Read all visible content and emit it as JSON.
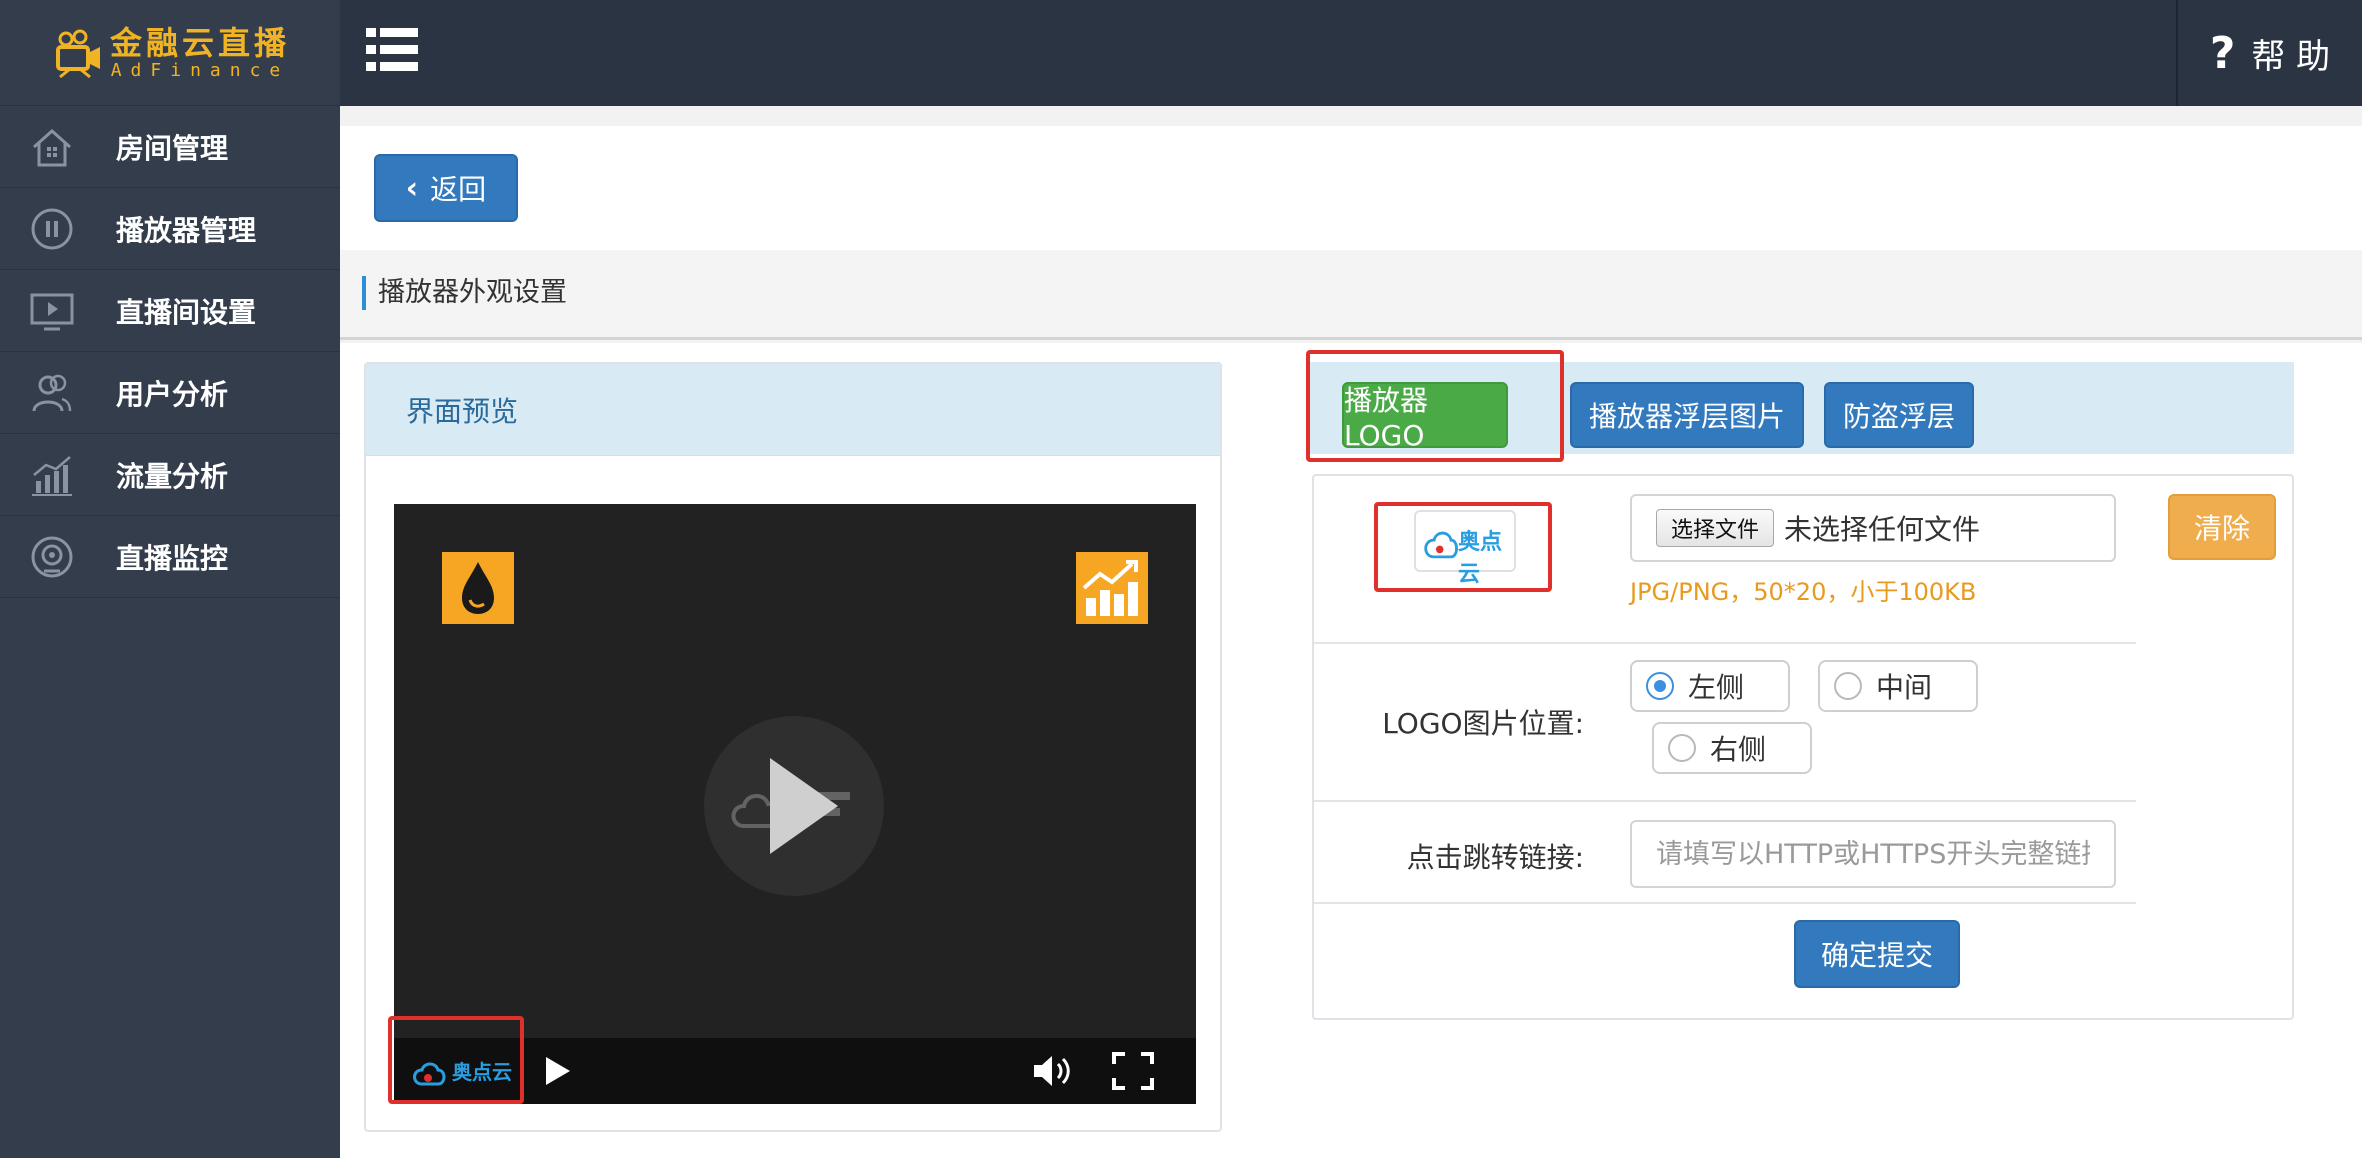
{
  "brand": {
    "name_cn": "金融云直播",
    "name_en": "AdFinance",
    "color": "#f0b323"
  },
  "sidebar": {
    "items": [
      {
        "label": "房间管理",
        "icon": "house-icon"
      },
      {
        "label": "播放器管理",
        "icon": "pause-circle-icon"
      },
      {
        "label": "直播间设置",
        "icon": "monitor-play-icon"
      },
      {
        "label": "用户分析",
        "icon": "users-icon"
      },
      {
        "label": "流量分析",
        "icon": "bar-chart-icon"
      },
      {
        "label": "直播监控",
        "icon": "webcam-icon"
      }
    ]
  },
  "topbar": {
    "menu_icon": "list-icon",
    "help_icon": "?",
    "help_label": "帮 助"
  },
  "toolbar": {
    "back_label": "返回"
  },
  "section": {
    "title": "播放器外观设置"
  },
  "preview": {
    "title": "界面预览",
    "player_logo_text": "奥点云"
  },
  "tabs": [
    {
      "label": "播放器LOGO",
      "active": true
    },
    {
      "label": "播放器浮层图片",
      "active": false
    },
    {
      "label": "防盗浮层",
      "active": false
    }
  ],
  "form": {
    "thumb_logo_text": "奥点云",
    "file_button_label": "选择文件",
    "file_status": "未选择任何文件",
    "file_hint": "JPG/PNG，50*20，小于100KB",
    "clear_label": "清除",
    "position_label": "LOGO图片位置:",
    "position_options": [
      {
        "label": "左侧",
        "checked": true
      },
      {
        "label": "中间",
        "checked": false
      },
      {
        "label": "右侧",
        "checked": false
      }
    ],
    "link_label": "点击跳转链接:",
    "link_placeholder": "请填写以HTTP或HTTPS开头完整链接",
    "submit_label": "确定提交"
  },
  "colors": {
    "sidebar_bg": "#333d4c",
    "topbar_bg": "#2b3443",
    "primary": "#3379bd",
    "success": "#4aab46",
    "warning": "#f0ad4e",
    "highlight": "#e0302b"
  }
}
